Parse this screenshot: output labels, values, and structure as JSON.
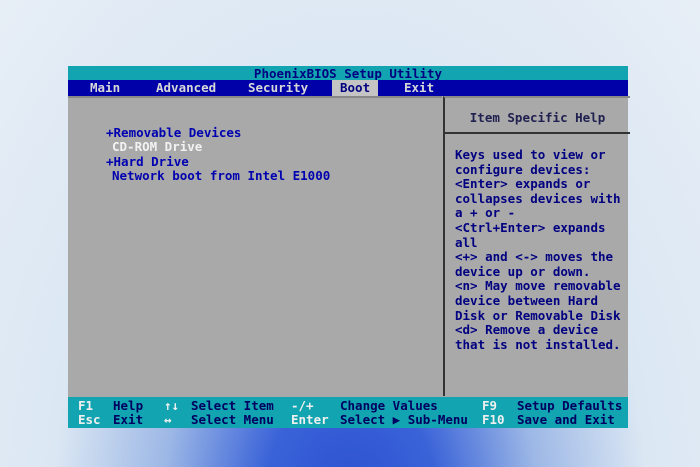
{
  "title": "PhoenixBIOS Setup Utility",
  "menu": [
    {
      "label": "Main"
    },
    {
      "label": "Advanced"
    },
    {
      "label": "Security"
    },
    {
      "label": "Boot",
      "active": true
    },
    {
      "label": "Exit"
    }
  ],
  "boot_items": [
    {
      "label": "+Removable Devices"
    },
    {
      "label": "CD-ROM Drive",
      "selected": true
    },
    {
      "label": "+Hard Drive"
    },
    {
      "label": "Network boot from Intel E1000"
    }
  ],
  "help": {
    "header": "Item Specific Help",
    "text": "Keys used to view or\nconfigure devices:\n<Enter> expands or\ncollapses devices with\na + or -\n<Ctrl+Enter> expands\nall\n<+> and <-> moves the\ndevice up or down.\n<n> May move removable\ndevice between Hard\nDisk or Removable Disk\n<d> Remove a device\nthat is not installed."
  },
  "footer": [
    {
      "key": "F1",
      "label": "Help"
    },
    {
      "key": "↑↓",
      "label": "Select Item"
    },
    {
      "key": "-/+",
      "label": "Change Values"
    },
    {
      "key": "F9",
      "label": "Setup Defaults"
    },
    {
      "key": "Esc",
      "label": "Exit"
    },
    {
      "key": "↔",
      "label": "Select Menu"
    },
    {
      "key": "Enter",
      "label": "Select ▶ Sub-Menu"
    },
    {
      "key": "F10",
      "label": "Save and Exit"
    }
  ]
}
